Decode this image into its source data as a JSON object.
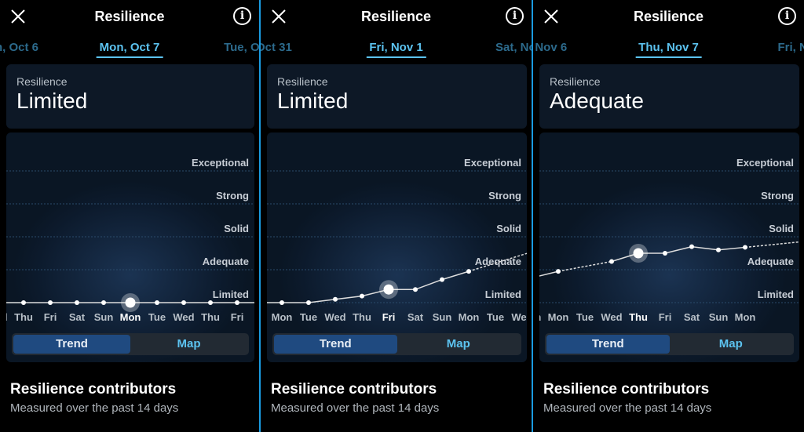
{
  "screens": [
    {
      "title": "Resilience",
      "date_prev": "n, Oct 6",
      "date_current": "Mon, Oct 7",
      "date_next": "Tue, Oct",
      "card_label": "Resilience",
      "card_value": "Limited",
      "days": [
        "Wed",
        "Thu",
        "Fri",
        "Sat",
        "Sun",
        "Mon",
        "Tue",
        "Wed",
        "Thu",
        "Fri"
      ],
      "values": [
        null,
        1,
        1,
        1,
        1,
        1,
        1,
        1,
        1,
        1
      ],
      "selected_index": 5,
      "trend_label": "Trend",
      "map_label": "Map",
      "active_tab": "Trend",
      "contributors_title": "Resilience contributors",
      "contributors_sub": "Measured over the past 14 days"
    },
    {
      "title": "Resilience",
      "date_prev": "Oct 31",
      "date_current": "Fri, Nov 1",
      "date_next": "Sat, Nov",
      "card_label": "Resilience",
      "card_value": "Limited",
      "days": [
        "Mon",
        "Tue",
        "Wed",
        "Thu",
        "Fri",
        "Sat",
        "Sun",
        "Mon",
        "Tue",
        "Wed"
      ],
      "values": [
        1,
        1,
        1.1,
        1.2,
        1.4,
        1.4,
        1.7,
        1.95,
        null,
        null
      ],
      "selected_index": 4,
      "trend_label": "Trend",
      "map_label": "Map",
      "active_tab": "Trend",
      "contributors_title": "Resilience contributors",
      "contributors_sub": "Measured over the past 14 days"
    },
    {
      "title": "Resilience",
      "date_prev": ", Nov 6",
      "date_current": "Thu, Nov 7",
      "date_next": "Fri, No",
      "card_label": "Resilience",
      "card_value": "Adequate",
      "days": [
        "Sun",
        "Mon",
        "Tue",
        "Wed",
        "Thu",
        "Fri",
        "Sat",
        "Sun",
        "Mon"
      ],
      "values": [
        1.75,
        1.95,
        null,
        2.25,
        2.5,
        2.5,
        2.7,
        2.6,
        2.68
      ],
      "selected_index": 4,
      "trend_label": "Trend",
      "map_label": "Map",
      "active_tab": "Trend",
      "contributors_title": "Resilience contributors",
      "contributors_sub": "Measured over the past 14 days"
    }
  ],
  "levels": [
    "Limited",
    "Adequate",
    "Solid",
    "Strong",
    "Exceptional"
  ],
  "colors": {
    "accent": "#5cc3f0",
    "separator": "#1a9be0",
    "tab_active": "#1f4a80",
    "card": "#0d1826"
  },
  "icons": {
    "close": "close-icon",
    "info": "info-icon"
  }
}
